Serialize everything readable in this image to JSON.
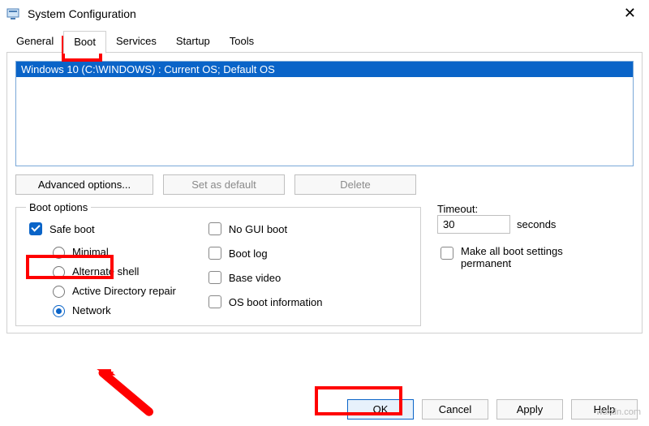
{
  "title": "System Configuration",
  "tabs": {
    "general": "General",
    "boot": "Boot",
    "services": "Services",
    "startup": "Startup",
    "tools": "Tools"
  },
  "os_entry": "Windows 10 (C:\\WINDOWS) : Current OS; Default OS",
  "buttons": {
    "advanced": "Advanced options...",
    "set_default": "Set as default",
    "delete": "Delete",
    "ok": "OK",
    "cancel": "Cancel",
    "apply": "Apply",
    "help": "Help"
  },
  "boot_options": {
    "legend": "Boot options",
    "safe_boot": "Safe boot",
    "minimal": "Minimal",
    "alt_shell": "Alternate shell",
    "ad_repair": "Active Directory repair",
    "network": "Network",
    "no_gui": "No GUI boot",
    "boot_log": "Boot log",
    "base_video": "Base video",
    "os_info": "OS boot information"
  },
  "timeout": {
    "label": "Timeout:",
    "value": "30",
    "unit": "seconds",
    "permanent": "Make all boot settings permanent"
  },
  "watermark": "wsxdn.com"
}
